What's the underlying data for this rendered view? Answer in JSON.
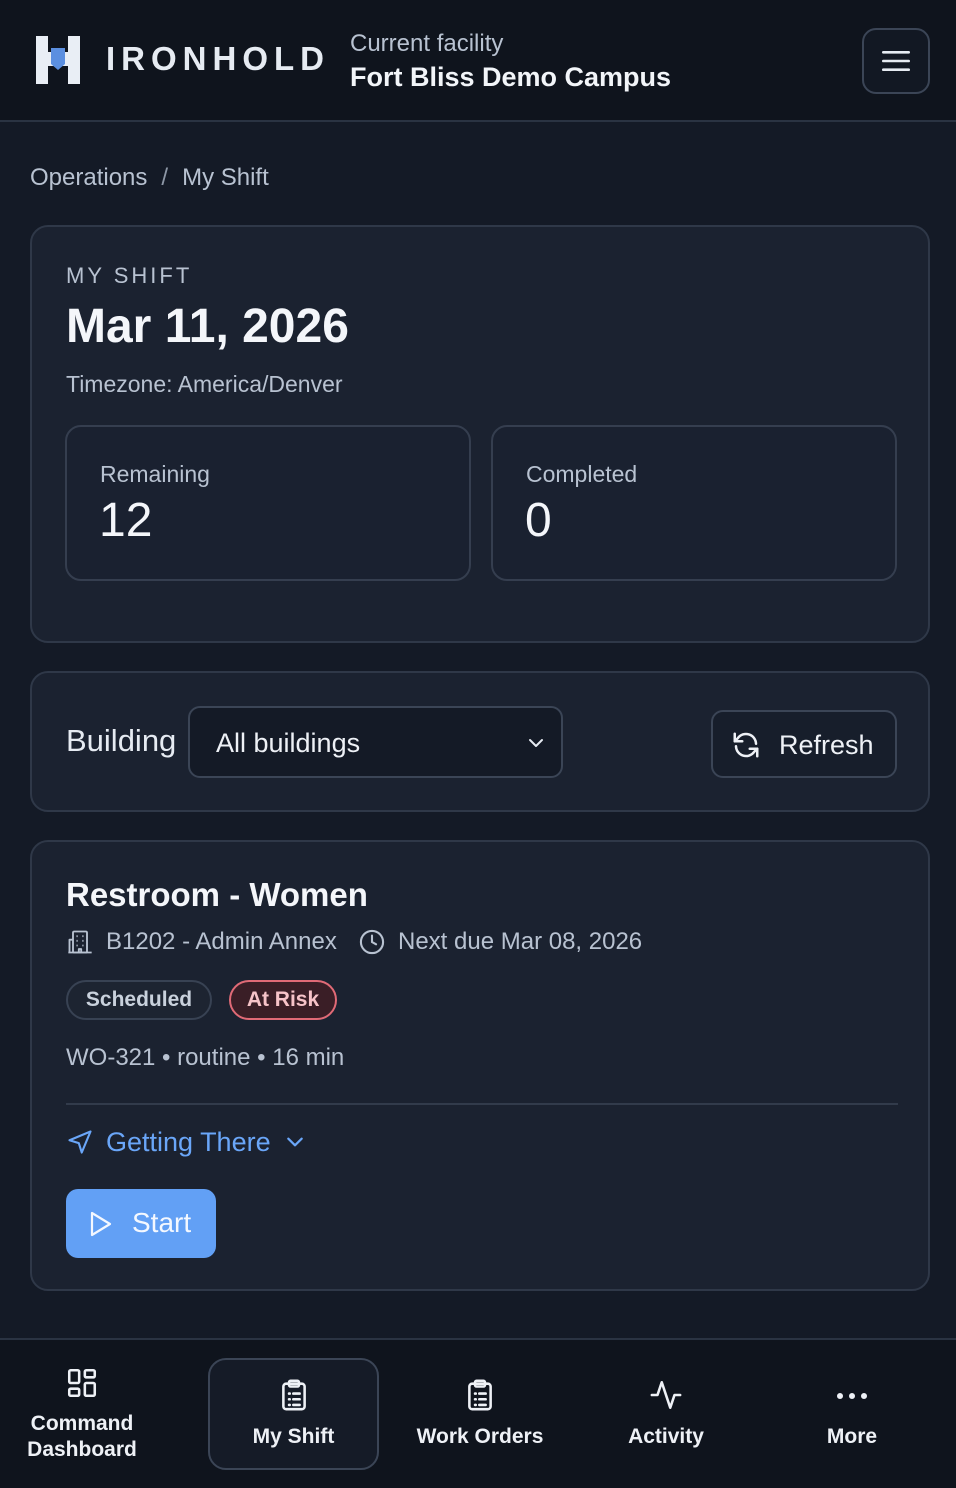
{
  "header": {
    "brand": "IRONHOLD",
    "facility_label": "Current facility",
    "facility_name": "Fort Bliss Demo Campus",
    "menu_icon": "hamburger-menu-icon"
  },
  "breadcrumb": {
    "parent": "Operations",
    "separator": "/",
    "current": "My Shift"
  },
  "shift": {
    "eyebrow": "MY SHIFT",
    "date": "Mar 11, 2026",
    "timezone": "Timezone: America/Denver",
    "stats": [
      {
        "label": "Remaining",
        "value": "12"
      },
      {
        "label": "Completed",
        "value": "0"
      }
    ]
  },
  "filter": {
    "label": "Building",
    "selected": "All buildings",
    "refresh_label": "Refresh"
  },
  "task": {
    "title": "Restroom - Women",
    "location": "B1202 - Admin Annex",
    "next_due": "Next due Mar 08, 2026",
    "status_badge": "Scheduled",
    "risk_badge": "At Risk",
    "details": "WO-321 • routine • 16 min",
    "getting_there": "Getting There",
    "start_label": "Start"
  },
  "colors": {
    "background": "#141a26",
    "accent": "#62a0f5",
    "link": "#6aa6f8",
    "risk": "#e06a76"
  },
  "nav": {
    "items": [
      {
        "line1": "Command",
        "line2": "Dashboard",
        "icon": "dashboard-grid-icon"
      },
      {
        "label": "My Shift",
        "icon": "clipboard-list-icon",
        "active": true
      },
      {
        "label": "Work Orders",
        "icon": "clipboard-list-icon"
      },
      {
        "label": "Activity",
        "icon": "activity-pulse-icon"
      },
      {
        "label": "More",
        "icon": "more-dots-icon"
      }
    ]
  }
}
